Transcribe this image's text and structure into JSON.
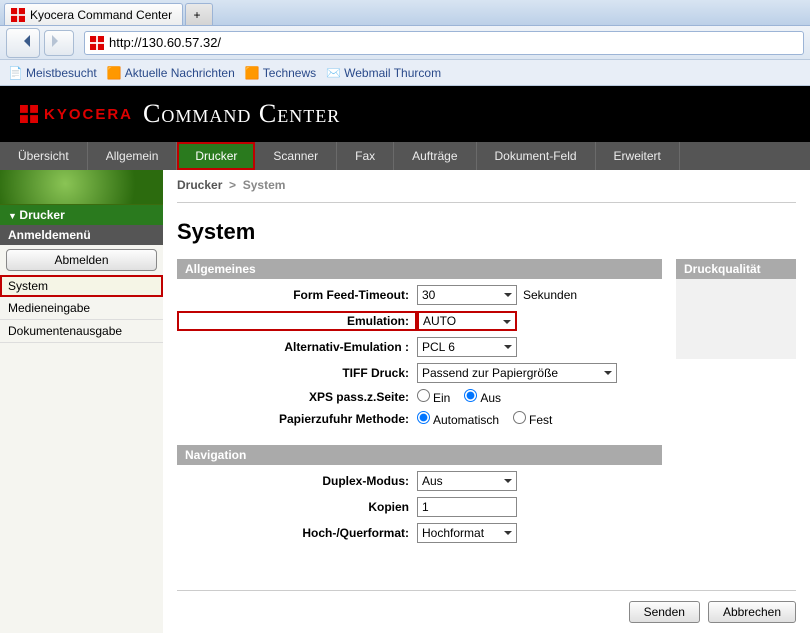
{
  "browser": {
    "tab_title": "Kyocera Command Center",
    "url": "http://130.60.57.32/",
    "bookmarks": [
      "Meistbesucht",
      "Aktuelle Nachrichten",
      "Technews",
      "Webmail Thurcom"
    ]
  },
  "header": {
    "brand_logo": "KYOCERA",
    "app_title": "Command Center"
  },
  "tabs": [
    "Übersicht",
    "Allgemein",
    "Drucker",
    "Scanner",
    "Fax",
    "Aufträge",
    "Dokument-Feld",
    "Erweitert"
  ],
  "active_tab": "Drucker",
  "breadcrumb": {
    "root": "Drucker",
    "sep": ">",
    "leaf": "System"
  },
  "page_title": "System",
  "sidebar": {
    "section": "Drucker",
    "submenu_title": "Anmeldemenü",
    "logout_btn": "Abmelden",
    "items": [
      "System",
      "Medieneingabe",
      "Dokumentenausgabe"
    ],
    "active_item": "System"
  },
  "sidepanel": {
    "title": "Druckqualität"
  },
  "sections": {
    "allgemeines": "Allgemeines",
    "navigation": "Navigation"
  },
  "form": {
    "form_feed_label": "Form Feed-Timeout:",
    "form_feed_value": "30",
    "form_feed_unit": "Sekunden",
    "emulation_label": "Emulation:",
    "emulation_value": "AUTO",
    "alt_emu_label": "Alternativ-Emulation :",
    "alt_emu_value": "PCL 6",
    "tiff_label": "TIFF Druck:",
    "tiff_value": "Passend zur Papiergröße",
    "xps_label": "XPS pass.z.Seite:",
    "xps_on": "Ein",
    "xps_off": "Aus",
    "paper_label": "Papierzufuhr Methode:",
    "paper_auto": "Automatisch",
    "paper_fix": "Fest",
    "duplex_label": "Duplex-Modus:",
    "duplex_value": "Aus",
    "copies_label": "Kopien",
    "copies_value": "1",
    "orient_label": "Hoch-/Querformat:",
    "orient_value": "Hochformat"
  },
  "actions": {
    "submit": "Senden",
    "cancel": "Abbrechen"
  }
}
